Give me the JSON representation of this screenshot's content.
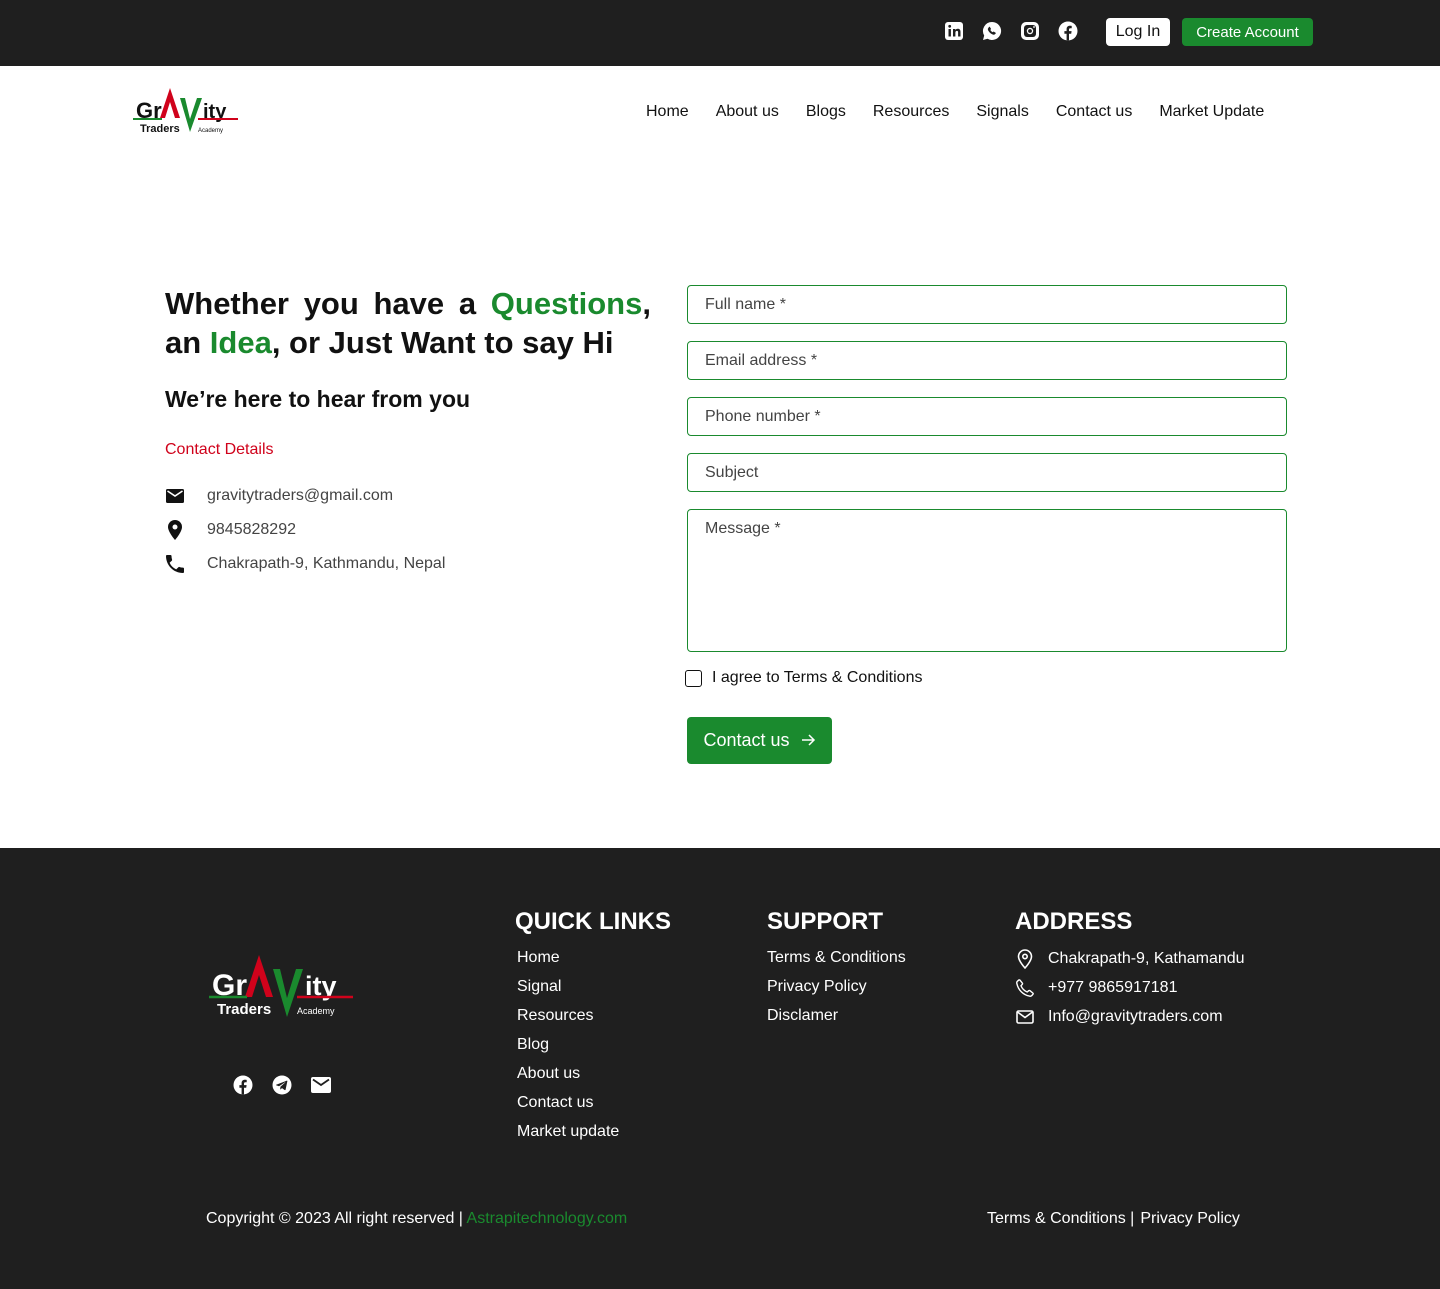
{
  "topbar": {
    "social": [
      "linkedin-icon",
      "whatsapp-icon",
      "instagram-icon",
      "facebook-icon"
    ],
    "login_label": "Log In",
    "create_account_label": "Create Account"
  },
  "header": {
    "logo": {
      "line1_left": "Gr",
      "line1_right": "ity",
      "line2_left": "Traders",
      "line2_right": "Academy"
    },
    "nav": [
      "Home",
      "About us",
      "Blogs",
      "Resources",
      "Signals",
      "Contact us",
      "Market Update"
    ]
  },
  "hero": {
    "title_part1": "Whether you have a ",
    "title_highlight1": "Questions",
    "title_part2": ", an ",
    "title_highlight2": "Idea",
    "title_part3": ", or Just Want to say Hi",
    "subtitle": "We’re here to hear from you",
    "contact_details_label": "Contact Details",
    "email": "gravitytraders@gmail.com",
    "phone": "9845828292",
    "address": "Chakrapath-9, Kathmandu, Nepal"
  },
  "form": {
    "full_name_placeholder": "Full name *",
    "email_placeholder": "Email address *",
    "phone_placeholder": "Phone number *",
    "subject_placeholder": "Subject",
    "message_placeholder": "Message *",
    "agree_label": "I agree to Terms & Conditions",
    "submit_label": "Contact us"
  },
  "footer": {
    "social": [
      "facebook-icon",
      "telegram-icon",
      "mail-icon"
    ],
    "quick_links_title": "QUICK LINKS",
    "quick_links": [
      "Home",
      "Signal",
      "Resources",
      "Blog",
      "About us",
      "Contact us",
      "Market update"
    ],
    "support_title": "SUPPORT",
    "support_links": [
      "Terms & Conditions",
      "Privacy Policy",
      "Disclamer"
    ],
    "address_title": "ADDRESS",
    "address": "Chakrapath-9, Kathamandu",
    "phone": "+977 9865917181",
    "email": "Info@gravitytraders.com",
    "copyright": "Copyright © 2023 All right reserved | ",
    "copyright_link": "Astrapitechnology.com",
    "terms": "Terms & Conditions |",
    "privacy": "Privacy Policy"
  },
  "colors": {
    "brand_green": "#1a8a2e",
    "brand_red": "#d0021b",
    "dark_bg": "#1f1f1f"
  }
}
